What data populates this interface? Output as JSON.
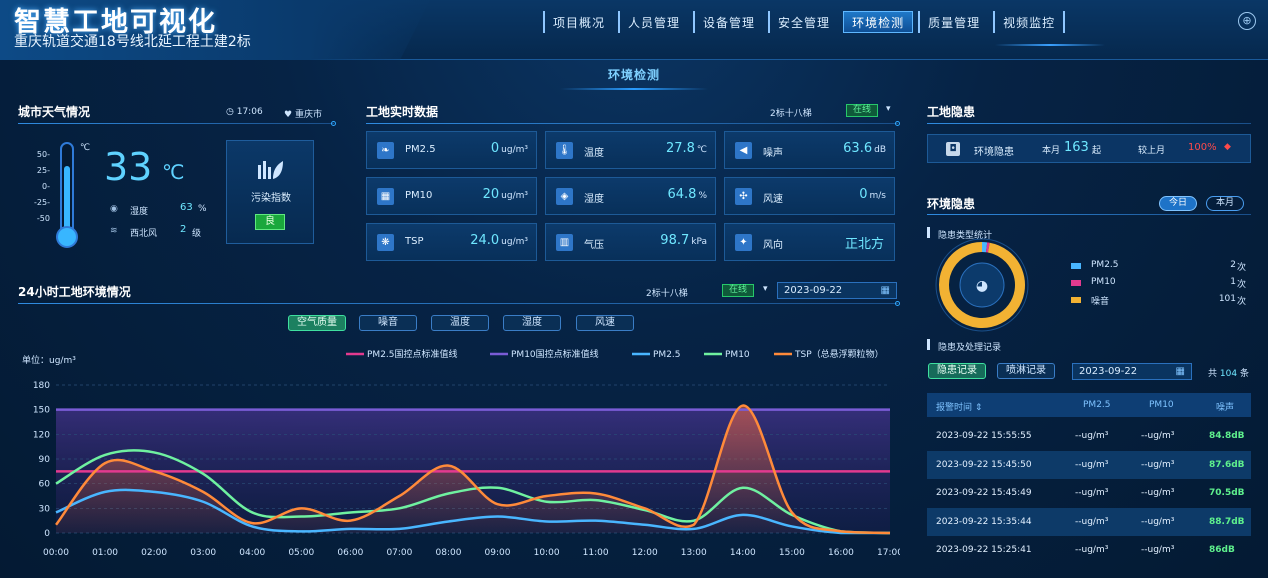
{
  "header": {
    "title": "智慧工地可视化",
    "subtitle": "重庆轨道交通18号线北延工程土建2标",
    "nav": [
      {
        "label": "项目概况",
        "active": false
      },
      {
        "label": "人员管理",
        "active": false
      },
      {
        "label": "设备管理",
        "active": false
      },
      {
        "label": "安全管理",
        "active": false
      },
      {
        "label": "环境检测",
        "active": true
      },
      {
        "label": "质量管理",
        "active": false
      },
      {
        "label": "视频监控",
        "active": false
      }
    ],
    "globe_icon": "globe-icon"
  },
  "page_title": "环境检测",
  "weather": {
    "heading": "城市天气情况",
    "time": "17:06",
    "city": "重庆市",
    "unit_c": "℃",
    "scale": [
      "50-",
      "25-",
      "0-",
      "-25-",
      "-50"
    ],
    "temperature": "33",
    "temperature_unit": "℃",
    "humidity_label": "湿度",
    "humidity_value": "63",
    "humidity_unit": "%",
    "wind_label": "西北风",
    "wind_value": "2",
    "wind_unit": "级",
    "pollution_label": "污染指数",
    "pollution_level": "良"
  },
  "realtime": {
    "heading": "工地实时数据",
    "site": "2标十八梯",
    "status": "在线",
    "cards": [
      {
        "label": "PM2.5",
        "value": "0",
        "unit": "ug/m³",
        "icon": "leaf-icon"
      },
      {
        "label": "温度",
        "value": "27.8",
        "unit": "℃",
        "icon": "thermometer-icon"
      },
      {
        "label": "噪声",
        "value": "63.6",
        "unit": "dB",
        "icon": "speaker-icon"
      },
      {
        "label": "PM10",
        "value": "20",
        "unit": "ug/m³",
        "icon": "dust-icon"
      },
      {
        "label": "湿度",
        "value": "64.8",
        "unit": "%",
        "icon": "droplet-icon"
      },
      {
        "label": "风速",
        "value": "0",
        "unit": "m/s",
        "icon": "fan-icon"
      },
      {
        "label": "TSP",
        "value": "24.0",
        "unit": "ug/m³",
        "icon": "particle-icon"
      },
      {
        "label": "气压",
        "value": "98.7",
        "unit": "kPa",
        "icon": "pressure-icon"
      },
      {
        "label": "风向",
        "value": "正北方",
        "unit": "",
        "icon": "wind-direction-icon"
      }
    ]
  },
  "env24": {
    "heading": "24小时工地环境情况",
    "site": "2标十八梯",
    "status": "在线",
    "date": "2023-09-22",
    "tabs": [
      {
        "label": "空气质量",
        "active": true
      },
      {
        "label": "噪音",
        "active": false
      },
      {
        "label": "温度",
        "active": false
      },
      {
        "label": "湿度",
        "active": false
      },
      {
        "label": "风速",
        "active": false
      }
    ]
  },
  "chart_data": {
    "type": "area",
    "unit_label": "单位：ug/m³",
    "x": [
      "00:00",
      "01:00",
      "02:00",
      "03:00",
      "04:00",
      "05:00",
      "06:00",
      "07:00",
      "08:00",
      "09:00",
      "10:00",
      "11:00",
      "12:00",
      "13:00",
      "14:00",
      "15:00",
      "16:00",
      "17:00"
    ],
    "ylim": [
      0,
      180
    ],
    "yticks": [
      0,
      30,
      60,
      90,
      120,
      150,
      180
    ],
    "grid": true,
    "legend_position": "top-right",
    "thresholds": [
      {
        "name": "PM2.5国控点标准值线",
        "value": 75,
        "color": "#e23a8f"
      },
      {
        "name": "PM10国控点标准值线",
        "value": 150,
        "color": "#7a5cd6"
      }
    ],
    "series": [
      {
        "name": "PM2.5",
        "color": "#49b6ff",
        "values": [
          25,
          50,
          50,
          38,
          8,
          2,
          5,
          5,
          14,
          20,
          14,
          15,
          10,
          5,
          22,
          8,
          0,
          0
        ]
      },
      {
        "name": "PM10",
        "color": "#6ff1a0",
        "values": [
          60,
          95,
          98,
          72,
          25,
          20,
          25,
          30,
          48,
          55,
          38,
          40,
          28,
          15,
          55,
          22,
          2,
          0
        ]
      },
      {
        "name": "TSP（总悬浮颗粒物）",
        "color": "#ff8a3a",
        "values": [
          10,
          85,
          75,
          50,
          12,
          30,
          15,
          45,
          82,
          35,
          45,
          48,
          30,
          10,
          155,
          25,
          2,
          0
        ]
      }
    ]
  },
  "hazard": {
    "heading": "工地隐患",
    "label": "环境隐患",
    "month_label": "本月",
    "month_value": "163",
    "month_unit": "起",
    "compare_label": "较上月",
    "compare_value": "100%",
    "env_heading": "环境隐患",
    "pill_today": "今日",
    "pill_month": "本月",
    "type_stats_label": "隐患类型统计",
    "donut": [
      {
        "name": "PM2.5",
        "count": 2,
        "unit": "次",
        "color": "#49b6ff"
      },
      {
        "name": "PM10",
        "count": 1,
        "unit": "次",
        "color": "#e23a8f"
      },
      {
        "name": "噪音",
        "count": 101,
        "unit": "次",
        "color": "#f2b233"
      }
    ],
    "records_label": "隐患及处理记录",
    "tab_records": "隐患记录",
    "tab_spray": "喷淋记录",
    "date": "2023-09-22",
    "total_prefix": "共",
    "total": "104",
    "total_suffix": "条",
    "columns": [
      "报警时间 ⇕",
      "PM2.5",
      "PM10",
      "噪声"
    ],
    "rows": [
      {
        "time": "2023-09-22 15:55:55",
        "pm25": "--ug/m³",
        "pm10": "--ug/m³",
        "noise": "84.8dB"
      },
      {
        "time": "2023-09-22 15:45:50",
        "pm25": "--ug/m³",
        "pm10": "--ug/m³",
        "noise": "87.6dB"
      },
      {
        "time": "2023-09-22 15:45:49",
        "pm25": "--ug/m³",
        "pm10": "--ug/m³",
        "noise": "70.5dB"
      },
      {
        "time": "2023-09-22 15:35:44",
        "pm25": "--ug/m³",
        "pm10": "--ug/m³",
        "noise": "88.7dB"
      },
      {
        "time": "2023-09-22 15:25:41",
        "pm25": "--ug/m³",
        "pm10": "--ug/m³",
        "noise": "86dB"
      }
    ]
  }
}
